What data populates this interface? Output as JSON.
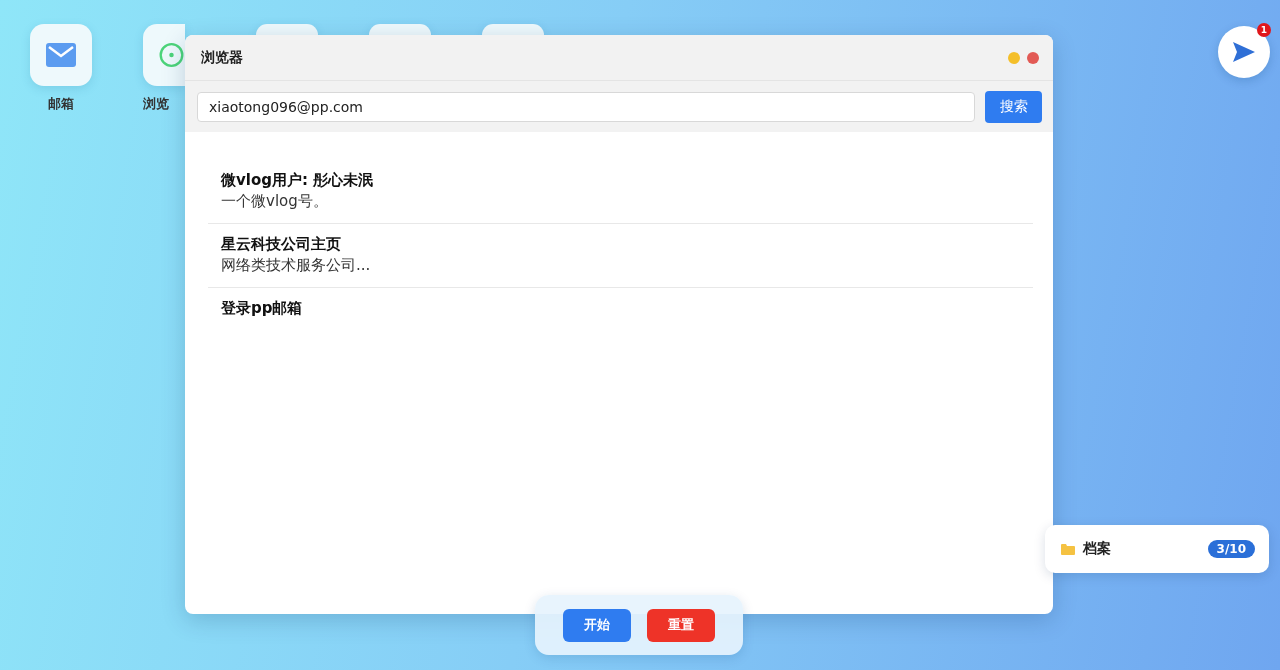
{
  "desktop": {
    "apps": [
      {
        "kind": "mail",
        "label": "邮箱"
      },
      {
        "kind": "browser",
        "label": "浏览"
      },
      {
        "kind": "blank"
      },
      {
        "kind": "blank"
      },
      {
        "kind": "blank"
      }
    ]
  },
  "window": {
    "title": "浏览器",
    "address": {
      "value": "xiaotong096@pp.com"
    },
    "search_button": "搜索",
    "results": [
      {
        "title": "微vlog用户: 彤心未泯",
        "description": "一个微vlog号。"
      },
      {
        "title": "星云科技公司主页",
        "description": "网络类技术服务公司..."
      },
      {
        "title": "登录pp邮箱"
      }
    ]
  },
  "send": {
    "badge": "1"
  },
  "archive": {
    "label": "档案",
    "count": "3/10"
  },
  "controls": [
    {
      "label": "开始",
      "kind": "start"
    },
    {
      "label": "重置",
      "kind": "reset"
    }
  ]
}
